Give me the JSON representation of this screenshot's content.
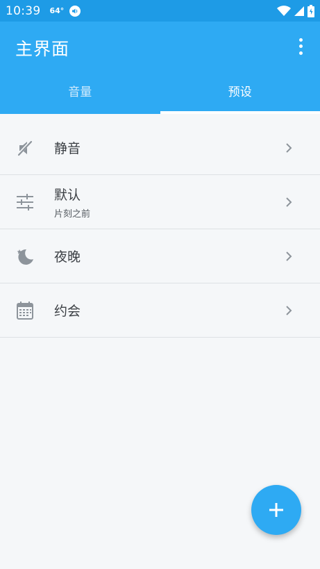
{
  "status_bar": {
    "time": "10:39",
    "temperature": "64°",
    "icons": [
      "volume-notification-icon",
      "wifi-icon",
      "cellular-signal-icon",
      "battery-icon"
    ]
  },
  "app_bar": {
    "title": "主界面",
    "menu_icon": "more-vert-icon",
    "background_color": "#2eaaf3"
  },
  "tabs": [
    {
      "label": "音量",
      "active": false
    },
    {
      "label": "预设",
      "active": true
    }
  ],
  "presets": [
    {
      "icon": "volume-mute-icon",
      "label": "静音",
      "subtitle": ""
    },
    {
      "icon": "tune-sliders-icon",
      "label": "默认",
      "subtitle": "片刻之前"
    },
    {
      "icon": "night-moon-icon",
      "label": "夜晚",
      "subtitle": ""
    },
    {
      "icon": "calendar-icon",
      "label": "约会",
      "subtitle": ""
    }
  ],
  "fab": {
    "icon": "add-icon"
  }
}
